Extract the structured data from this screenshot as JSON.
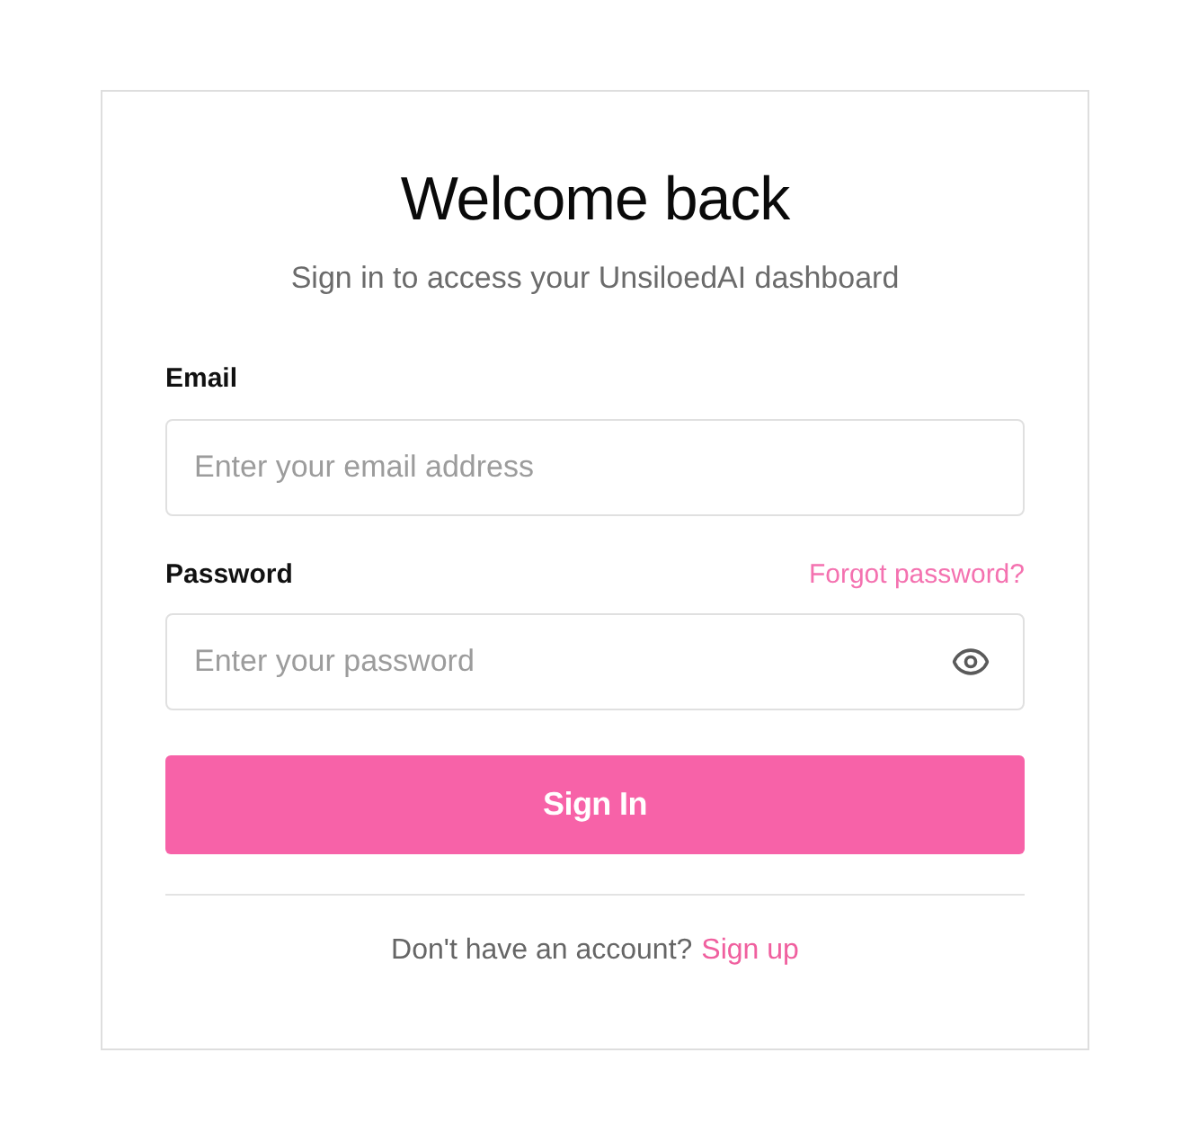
{
  "header": {
    "title": "Welcome back",
    "subtitle": "Sign in to access your UnsiloedAI dashboard"
  },
  "fields": [
    {
      "kind": "email",
      "label": "Email",
      "placeholder": "Enter your email address"
    },
    {
      "kind": "password",
      "label": "Password",
      "placeholder": "Enter your password",
      "link": "Forgot password?"
    }
  ],
  "submit": {
    "label": "Sign In"
  },
  "footer": {
    "prompt": "Don't have an account?",
    "link": "Sign up"
  }
}
